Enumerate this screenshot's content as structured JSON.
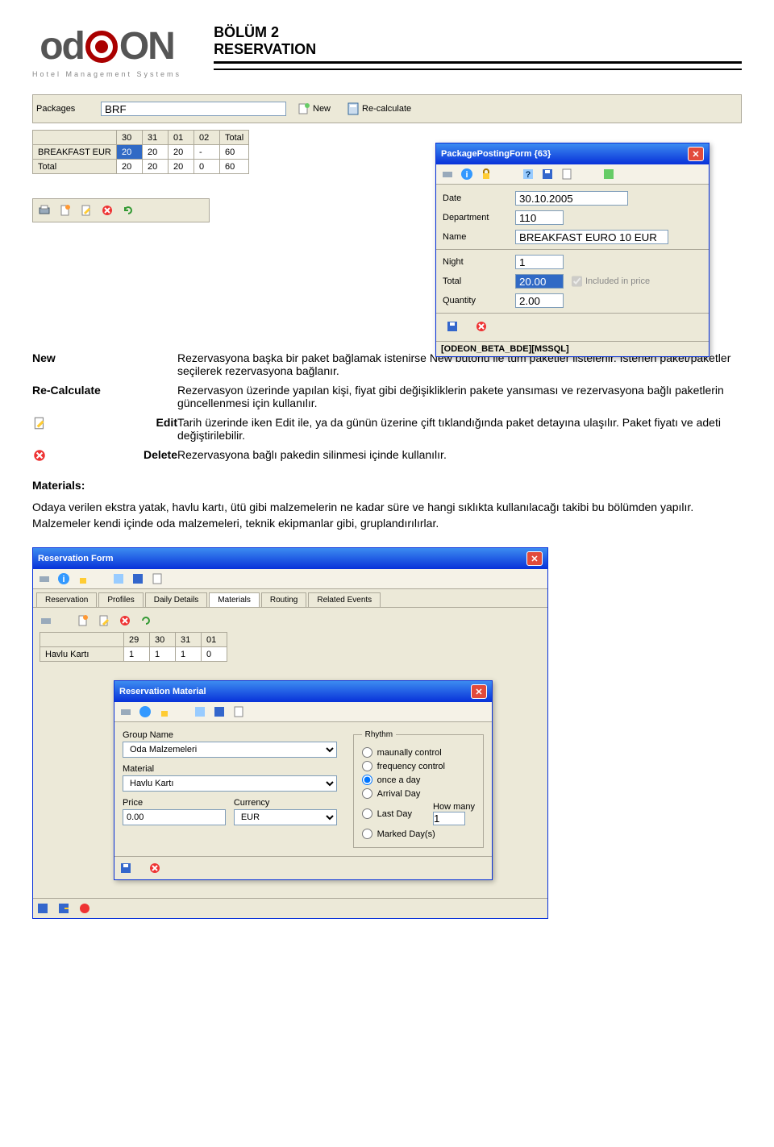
{
  "page": {
    "title_line1": "BÖLÜM 2",
    "title_line2": "RESERVATION",
    "logo_text_left": "od",
    "logo_text_right": "ON",
    "logo_subtitle": "Hotel Management Systems"
  },
  "packages_panel": {
    "label": "Packages",
    "value": "BRF",
    "new_btn": "New",
    "recalc_btn": "Re-calculate",
    "grid": {
      "cols": [
        "",
        "30",
        "31",
        "01",
        "02",
        "Total"
      ],
      "rows": [
        {
          "head": "BREAKFAST EUR",
          "cells": [
            "20",
            "20",
            "20",
            "-",
            "60"
          ],
          "sel": 0
        },
        {
          "head": "Total",
          "cells": [
            "20",
            "20",
            "20",
            "0",
            "60"
          ]
        }
      ]
    }
  },
  "posting_form": {
    "title": "PackagePostingForm {63}",
    "date_label": "Date",
    "date_value": "30.10.2005",
    "department_label": "Department",
    "department_value": "110",
    "name_label": "Name",
    "name_value": "BREAKFAST EURO 10 EUR",
    "night_label": "Night",
    "night_value": "1",
    "total_label": "Total",
    "total_value": "20.00",
    "included_label": "Included in price",
    "quantity_label": "Quantity",
    "quantity_value": "2.00",
    "status": "[ODEON_BETA_BDE][MSSQL]"
  },
  "definitions": [
    {
      "key": "New",
      "desc": "Rezervasyona başka bir paket bağlamak istenirse New butonu ile tüm paketler listelenir. İstenen paket/paketler seçilerek rezervasyona bağlanır.",
      "icon": ""
    },
    {
      "key": "Re-Calculate",
      "desc": "Rezervasyon üzerinde yapılan kişi, fiyat gibi değişikliklerin pakete yansıması ve rezervasyona bağlı paketlerin güncellenmesi için kullanılır.",
      "icon": ""
    },
    {
      "key": "Edit",
      "desc": "Tarih üzerinde iken Edit ile, ya da günün üzerine çift tıklandığında paket detayına ulaşılır. Paket fiyatı ve adeti değiştirilebilir.",
      "icon": "edit"
    },
    {
      "key": "Delete",
      "desc": "Rezervasyona bağlı pakedin silinmesi içinde kullanılır.",
      "icon": "delete"
    }
  ],
  "materials": {
    "heading": "Materials:",
    "text": "Odaya verilen ekstra yatak, havlu kartı, ütü gibi malzemelerin ne kadar süre ve hangi sıklıkta kullanılacağı takibi bu bölümden yapılır. Malzemeler kendi içinde oda malzemeleri, teknik ekipmanlar gibi, gruplandırılırlar."
  },
  "reservation_form": {
    "title": "Reservation Form",
    "tabs": [
      "Reservation",
      "Profiles",
      "Daily Details",
      "Materials",
      "Routing",
      "Related Events"
    ],
    "active_tab": 3,
    "grid": {
      "cols": [
        "",
        "29",
        "30",
        "31",
        "01"
      ],
      "rows": [
        {
          "head": "Havlu Kartı",
          "cells": [
            "1",
            "1",
            "1",
            "0"
          ]
        }
      ]
    }
  },
  "material_form": {
    "title": "Reservation Material",
    "group_label": "Group Name",
    "group_value": "Oda Malzemeleri",
    "material_label": "Material",
    "material_value": "Havlu Kartı",
    "price_label": "Price",
    "price_value": "0.00",
    "currency_label": "Currency",
    "currency_value": "EUR",
    "rhythm_legend": "Rhythm",
    "rhythm_options": [
      "maunally control",
      "frequency control",
      "once a day",
      "Arrival Day",
      "Last Day",
      "Marked Day(s)"
    ],
    "rhythm_selected": 2,
    "howmany_label": "How many",
    "howmany_value": "1"
  }
}
